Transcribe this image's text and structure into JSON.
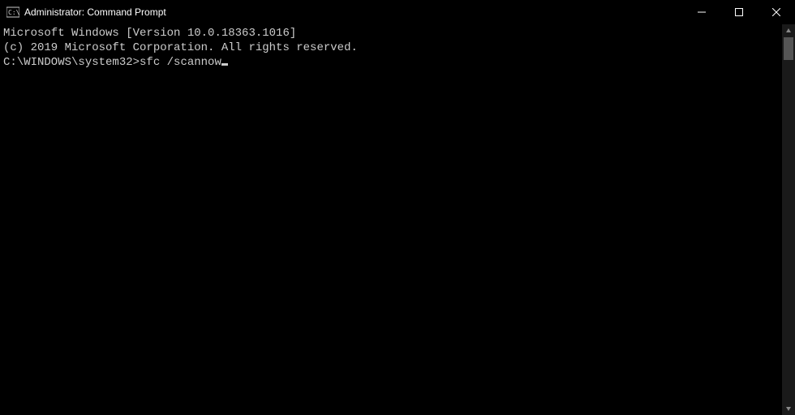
{
  "titlebar": {
    "title": "Administrator: Command Prompt"
  },
  "terminal": {
    "line1": "Microsoft Windows [Version 10.0.18363.1016]",
    "line2": "(c) 2019 Microsoft Corporation. All rights reserved.",
    "blank": "",
    "prompt": "C:\\WINDOWS\\system32>",
    "command": "sfc /scannow"
  }
}
